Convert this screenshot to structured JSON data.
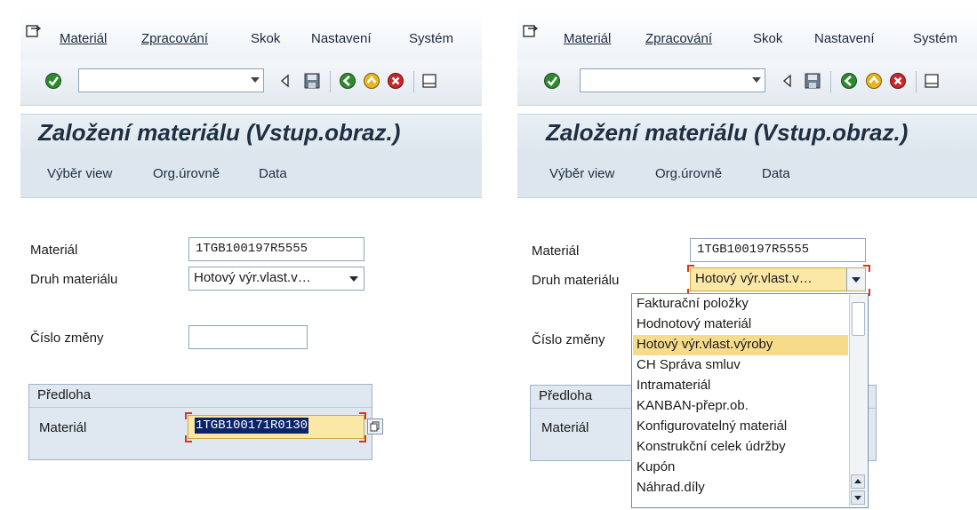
{
  "menu": {
    "items": [
      {
        "label": "Materiál"
      },
      {
        "label": "Zpracování"
      },
      {
        "label": "Skok"
      },
      {
        "label": "Nastavení"
      },
      {
        "label": "Systém"
      }
    ]
  },
  "toolbar": {
    "command_value": "",
    "icons": [
      "enter-icon",
      "back-triangle-icon",
      "save-icon",
      "back-icon",
      "exit-icon",
      "cancel-icon",
      "print-icon"
    ]
  },
  "screen": {
    "title": "Založení materiálu (Vstup.obraz.)",
    "app_buttons": [
      "Výběr view",
      "Org.úrovně",
      "Data"
    ]
  },
  "form": {
    "material_label": "Materiál",
    "material_value": "1TGB100197R5555",
    "type_label": "Druh materiálu",
    "type_value": "Hotový výr.vlast.v…",
    "change_label": "Číslo změny",
    "change_value": "",
    "template_title": "Předloha",
    "template_material_label": "Materiál",
    "template_material_value": "1TGB100171R0130"
  },
  "dropdown": {
    "selected": "Hotový výr.vlast.výroby",
    "options": [
      "Fakturační položky",
      "Hodnotový materiál",
      "Hotový výr.vlast.výroby",
      "CH Správa smluv",
      "Intramateriál",
      "KANBAN-přepr.ob.",
      "Konfigurovatelný materiál",
      "Konstrukční celek údržby",
      "Kupón",
      "Náhrad.díly"
    ]
  },
  "colors": {
    "accent": "#1e2f42",
    "highlight": "#f6dc8a",
    "selection": "#0a246a",
    "error_marker": "#d9341f"
  }
}
